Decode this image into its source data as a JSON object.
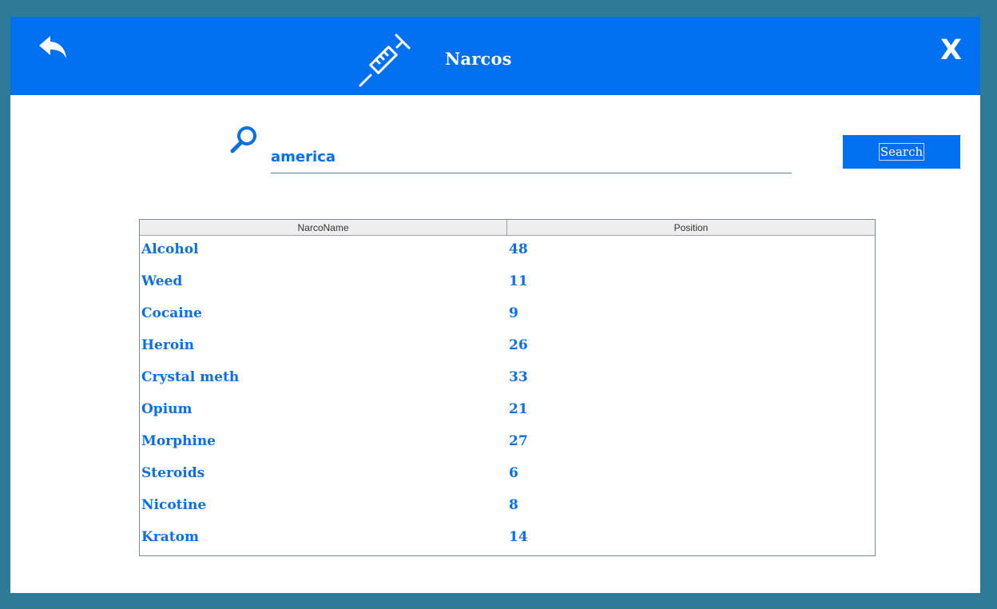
{
  "header": {
    "title": "Narcos",
    "back_icon": "back-arrow-icon",
    "logo_icon": "syringe-icon",
    "close_label": "X"
  },
  "search": {
    "value": "america",
    "icon": "magnifier-icon",
    "button_label": "Search"
  },
  "table": {
    "columns": [
      "NarcoName",
      "Position"
    ],
    "rows": [
      {
        "name": "Alcohol",
        "position": "48"
      },
      {
        "name": "Weed",
        "position": "11"
      },
      {
        "name": "Cocaine",
        "position": "9"
      },
      {
        "name": "Heroin",
        "position": "26"
      },
      {
        "name": "Crystal meth",
        "position": "33"
      },
      {
        "name": "Opium",
        "position": "21"
      },
      {
        "name": "Morphine",
        "position": "27"
      },
      {
        "name": "Steroids",
        "position": "6"
      },
      {
        "name": "Nicotine",
        "position": "8"
      },
      {
        "name": "Kratom",
        "position": "14"
      }
    ]
  },
  "colors": {
    "accent": "#0070f0",
    "frame": "#2e7b98",
    "text": "#0a6fe0"
  }
}
